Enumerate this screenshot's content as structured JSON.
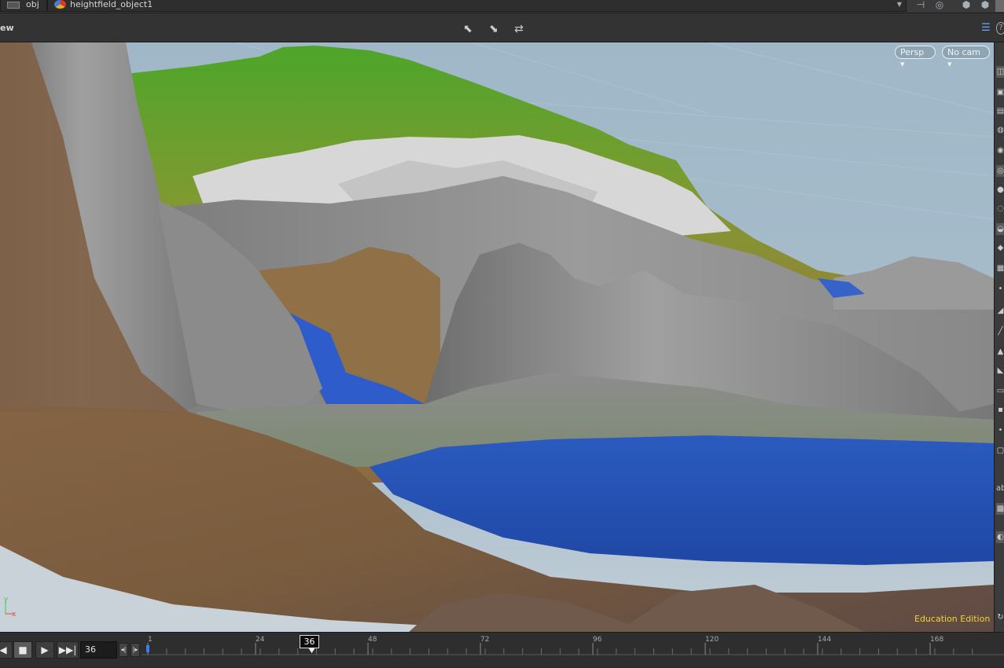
{
  "pathbar": {
    "crumbs": [
      {
        "label": "obj",
        "icon": "network-icon"
      },
      {
        "label": "heightfield_object1",
        "icon": "heightfield-icon"
      }
    ],
    "icons": [
      "pin-icon",
      "target-icon",
      "cube-icon",
      "cube-menu-icon"
    ]
  },
  "toolbar": {
    "view_label": "ew",
    "tools": [
      "select-tool-icon",
      "select-tool-2-icon",
      "transform-handle-icon"
    ],
    "display_options": "display-options-icon",
    "help_glyph": "?"
  },
  "viewport": {
    "persp_label": "Persp ▾",
    "cam_label": "No cam ▾",
    "watermark": "Education Edition",
    "axis_y": "y",
    "axis_x": "x",
    "colors": {
      "sky": "#a9bdcb",
      "grass": "#4d9a2c",
      "rock": "#8a8a8a",
      "soil": "#7b5c3c",
      "water": "#2a55b8",
      "snow": "#d9d9d9"
    }
  },
  "right_shelf": {
    "icons": [
      "camera-icon",
      "lock-icon",
      "light-icon",
      "sphere-icon",
      "eye-icon",
      "grid-icon",
      "snap-icon",
      "wire-icon",
      "shade-icon",
      "points-icon",
      "normals-icon",
      "uv-icon",
      "texture-icon",
      "ghost-icon",
      "background-icon",
      "display-icon",
      "text-label-icon",
      "camera-view-icon",
      "home-icon"
    ],
    "text_label": "ab"
  },
  "timeline": {
    "current_frame": "36",
    "frame_input": "36",
    "tick_labels": [
      "1",
      "24",
      "48",
      "72",
      "96",
      "120",
      "144",
      "168"
    ],
    "buttons": {
      "prev": "◀",
      "stop": "■",
      "play": "▶",
      "end": "▶▶|",
      "step_back": "◂|",
      "step_fwd": "|▸"
    }
  }
}
